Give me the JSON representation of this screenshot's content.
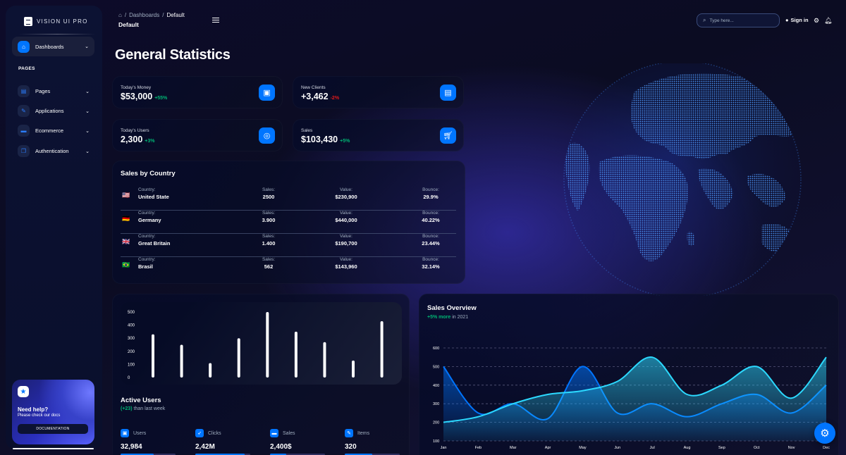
{
  "sidebar": {
    "brand": "VISION UI PRO",
    "active": {
      "label": "Dashboards",
      "icon": "home-icon"
    },
    "section": "PAGES",
    "items": [
      {
        "label": "Pages",
        "icon": "document-icon"
      },
      {
        "label": "Applications",
        "icon": "wrench-icon"
      },
      {
        "label": "Ecommerce",
        "icon": "cart-icon"
      },
      {
        "label": "Authentication",
        "icon": "copy-icon"
      }
    ],
    "help": {
      "title": "Need help?",
      "subtitle": "Please check our docs",
      "button": "DOCUMENTATION"
    }
  },
  "header": {
    "breadcrumb_root": "Dashboards",
    "breadcrumb_current": "Default",
    "crumb_title": "Default",
    "search_placeholder": "Type here...",
    "signin": "Sign in"
  },
  "page": {
    "title": "General Statistics"
  },
  "stats": [
    {
      "label": "Today's Money",
      "value": "$53,000",
      "change": "+55%",
      "trend": "pos",
      "icon": "wallet-icon"
    },
    {
      "label": "New Clients",
      "value": "+3,462",
      "change": "-2%",
      "trend": "neg",
      "icon": "document-icon"
    },
    {
      "label": "Today's Users",
      "value": "2,300",
      "change": "+3%",
      "trend": "pos",
      "icon": "globe-icon"
    },
    {
      "label": "Sales",
      "value": "$103,430",
      "change": "+5%",
      "trend": "pos",
      "icon": "cart-icon"
    }
  ],
  "sales_by_country": {
    "title": "Sales by Country",
    "keys": {
      "country": "Country:",
      "sales": "Sales:",
      "value": "Value:",
      "bounce": "Bounce:"
    },
    "rows": [
      {
        "flag": "🇺🇸",
        "country": "United State",
        "sales": "2500",
        "value": "$230,900",
        "bounce": "29.9%"
      },
      {
        "flag": "🇩🇪",
        "country": "Germany",
        "sales": "3.900",
        "value": "$440,000",
        "bounce": "40.22%"
      },
      {
        "flag": "🇬🇧",
        "country": "Great Britain",
        "sales": "1.400",
        "value": "$190,700",
        "bounce": "23.44%"
      },
      {
        "flag": "🇧🇷",
        "country": "Brasil",
        "sales": "562",
        "value": "$143,960",
        "bounce": "32.14%"
      }
    ]
  },
  "active_users": {
    "title": "Active Users",
    "sub_change": "(+23)",
    "sub_text": "than last week",
    "stats": [
      {
        "label": "Users",
        "value": "32,984",
        "icon": "wallet-icon",
        "progress": 0.6
      },
      {
        "label": "Clicks",
        "value": "2,42M",
        "icon": "rocket-icon",
        "progress": 0.9
      },
      {
        "label": "Sales",
        "value": "2,400$",
        "icon": "cart-icon",
        "progress": 0.3
      },
      {
        "label": "Items",
        "value": "320",
        "icon": "wrench-icon",
        "progress": 0.5
      }
    ]
  },
  "sales_overview": {
    "title": "Sales Overview",
    "change": "+5% more",
    "change_suffix": "in 2021"
  },
  "chart_data": [
    {
      "type": "bar",
      "categories": [
        "",
        "",
        "",
        "",
        "",
        "",
        "",
        "",
        ""
      ],
      "values": [
        330,
        250,
        110,
        300,
        500,
        350,
        270,
        130,
        430
      ],
      "yticks": [
        0,
        100,
        200,
        300,
        400,
        500
      ],
      "ylim": [
        0,
        500
      ],
      "color": "#ffffff"
    },
    {
      "type": "area",
      "categories": [
        "Jan",
        "Feb",
        "Mar",
        "Apr",
        "May",
        "Jun",
        "Jul",
        "Aug",
        "Sep",
        "Oct",
        "Nov",
        "Dec"
      ],
      "yticks": [
        100,
        200,
        300,
        400,
        500,
        600
      ],
      "ylim": [
        100,
        600
      ],
      "series": [
        {
          "values": [
            500,
            250,
            300,
            220,
            500,
            250,
            300,
            230,
            300,
            350,
            250,
            400
          ],
          "color": "#0075ff"
        },
        {
          "values": [
            200,
            230,
            300,
            350,
            370,
            420,
            550,
            350,
            400,
            500,
            330,
            550
          ],
          "color": "#2cd9ff"
        }
      ]
    }
  ]
}
